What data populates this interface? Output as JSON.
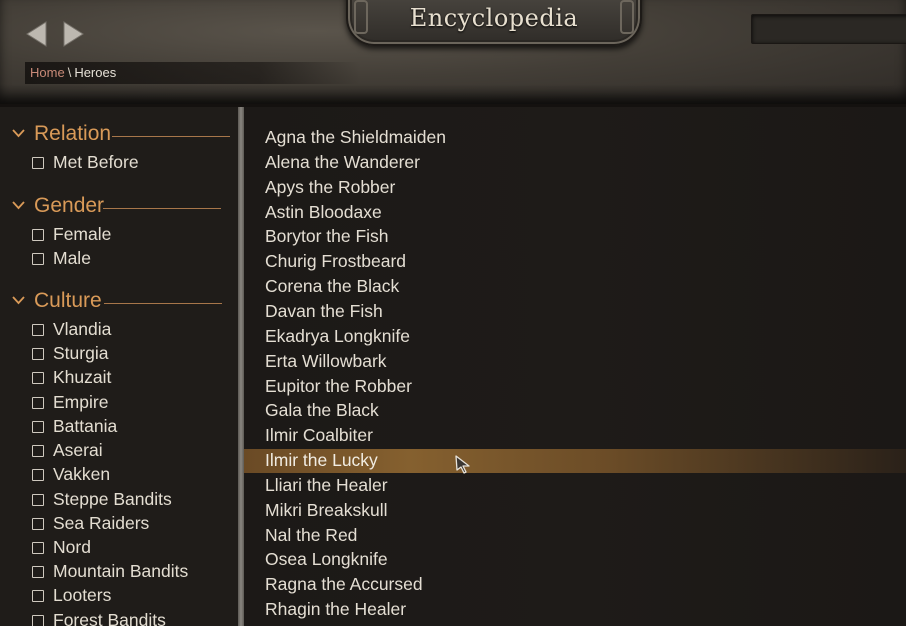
{
  "header": {
    "title": "Encyclopedia",
    "breadcrumb": {
      "home": "Home",
      "separator": "\\",
      "current": "Heroes"
    },
    "search_value": ""
  },
  "filters": [
    {
      "title": "Relation",
      "options": [
        "Met Before"
      ]
    },
    {
      "title": "Gender",
      "options": [
        "Female",
        "Male"
      ]
    },
    {
      "title": "Culture",
      "options": [
        "Vlandia",
        "Sturgia",
        "Khuzait",
        "Empire",
        "Battania",
        "Aserai",
        "Vakken",
        "Steppe Bandits",
        "Sea Raiders",
        "Nord",
        "Mountain Bandits",
        "Looters",
        "Forest Bandits"
      ]
    }
  ],
  "heroes": [
    "Agna the Shieldmaiden",
    "Alena the Wanderer",
    "Apys the Robber",
    "Astin Bloodaxe",
    "Borytor the Fish",
    "Churig Frostbeard",
    "Corena the Black",
    "Davan the Fish",
    "Ekadrya Longknife",
    "Erta Willowbark",
    "Eupitor the Robber",
    "Gala the Black",
    "Ilmir Coalbiter",
    "Ilmir the Lucky",
    "Lliari the Healer",
    "Mikri Breakskull",
    "Nal the Red",
    "Osea Longknife",
    "Ragna the Accursed",
    "Rhagin the Healer"
  ],
  "selected_hero": "Ilmir the Lucky",
  "colors": {
    "accent": "#d99a58",
    "breadcrumb_home": "#c98a78",
    "selected_row": "#85602f"
  },
  "icons": {
    "back": "left-arrow-icon",
    "forward": "right-arrow-icon",
    "expand": "chevron-down-icon",
    "checkbox": "checkbox-unchecked-icon",
    "cursor": "mouse-pointer-icon"
  }
}
